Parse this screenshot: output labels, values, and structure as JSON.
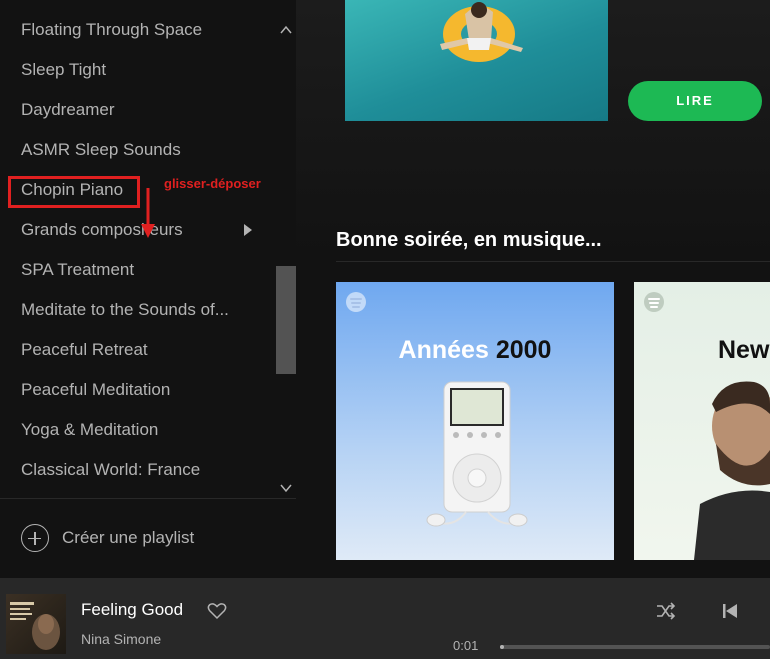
{
  "sidebar": {
    "playlists": [
      {
        "label": "Floating Through Space"
      },
      {
        "label": "Sleep Tight"
      },
      {
        "label": "Daydreamer"
      },
      {
        "label": "ASMR Sleep Sounds"
      },
      {
        "label": "Chopin Piano"
      },
      {
        "label": "Grands compositeurs"
      },
      {
        "label": "SPA Treatment"
      },
      {
        "label": "Meditate to the Sounds of..."
      },
      {
        "label": "Peaceful Retreat"
      },
      {
        "label": "Peaceful Meditation"
      },
      {
        "label": "Yoga & Meditation"
      },
      {
        "label": "Classical World: France"
      }
    ],
    "create_playlist_label": "Créer une playlist"
  },
  "annotation": {
    "label": "glisser-déposer",
    "color": "#e02020"
  },
  "main": {
    "play_button_label": "LIRE",
    "section_title": "Bonne soirée, en musique...",
    "cards": [
      {
        "title_light": "Années",
        "title_dark": "2000"
      },
      {
        "title_dark": "New"
      }
    ]
  },
  "player": {
    "track_title": "Feeling Good",
    "track_artist": "Nina Simone",
    "elapsed": "0:01",
    "progress_fraction": 0.01
  },
  "colors": {
    "accent": "#1db954",
    "background": "#121212",
    "player_bg": "#282828"
  }
}
